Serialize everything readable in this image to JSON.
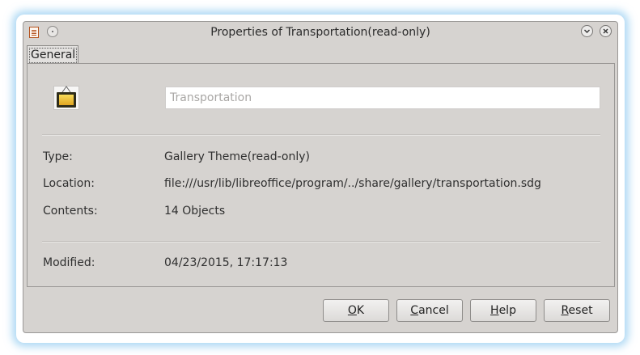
{
  "window": {
    "title": "Properties of Transportation(read-only)"
  },
  "tabs": [
    {
      "label": "General"
    }
  ],
  "general": {
    "name_value": "Transportation",
    "type_label": "Type:",
    "type_value": "Gallery Theme(read-only)",
    "location_label": "Location:",
    "location_value": "file:///usr/lib/libreoffice/program/../share/gallery/transportation.sdg",
    "contents_label": "Contents:",
    "contents_value": "14 Objects",
    "modified_label": "Modified:",
    "modified_value": "04/23/2015, 17:17:13"
  },
  "buttons": {
    "ok": {
      "mnemonic": "O",
      "rest": "K"
    },
    "cancel": {
      "mnemonic": "C",
      "rest": "ancel"
    },
    "help": {
      "mnemonic": "H",
      "rest": "elp"
    },
    "reset": {
      "mnemonic": "R",
      "rest": "eset"
    }
  },
  "icons": {
    "app": "libreoffice-document-icon",
    "menu": "window-menu-icon",
    "minimize": "minimize-icon",
    "close": "close-icon",
    "theme": "gallery-theme-icon"
  },
  "colors": {
    "window_bg": "#d6d3d0",
    "glow": "#6eb9eb",
    "field_text": "#a9a7a5"
  }
}
